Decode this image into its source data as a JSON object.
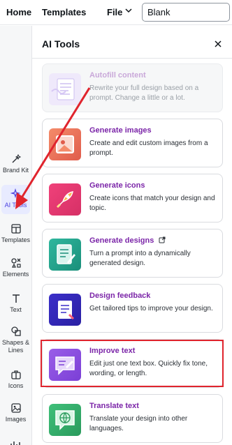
{
  "topbar": {
    "home": "Home",
    "templates": "Templates",
    "file": "File",
    "design_title": "Blank"
  },
  "rail": {
    "items": [
      {
        "label": "Brand Kit",
        "icon": "brand-kit-icon"
      },
      {
        "label": "AI Tools",
        "icon": "ai-sparkle-icon",
        "active": true
      },
      {
        "label": "Templates",
        "icon": "templates-icon"
      },
      {
        "label": "Elements",
        "icon": "elements-icon"
      },
      {
        "label": "Text",
        "icon": "text-icon"
      },
      {
        "label": "Shapes &\nLines",
        "icon": "shapes-icon"
      },
      {
        "label": "Icons",
        "icon": "icons-icon"
      },
      {
        "label": "Images",
        "icon": "images-icon"
      }
    ]
  },
  "panel": {
    "title": "AI Tools",
    "cards": [
      {
        "title": "Autofill content",
        "desc": "Rewrite your full design based on a prompt. Change a little or a lot.",
        "disabled": true
      },
      {
        "title": "Generate images",
        "desc": "Create and edit custom images from a prompt."
      },
      {
        "title": "Generate icons",
        "desc": "Create icons that match your design and topic."
      },
      {
        "title": "Generate designs",
        "desc": "Turn a prompt into a dynamically generated design."
      },
      {
        "title": "Design feedback",
        "desc": "Get tailored tips to improve your design."
      },
      {
        "title": "Improve text",
        "desc": "Edit just one text box. Quickly fix tone, wording, or length."
      },
      {
        "title": "Translate text",
        "desc": "Translate your design into other languages."
      }
    ]
  },
  "colors": {
    "accent_purple": "#7b25a8",
    "highlight_red": "#e0242d",
    "active_rail": "#4a3fde"
  }
}
